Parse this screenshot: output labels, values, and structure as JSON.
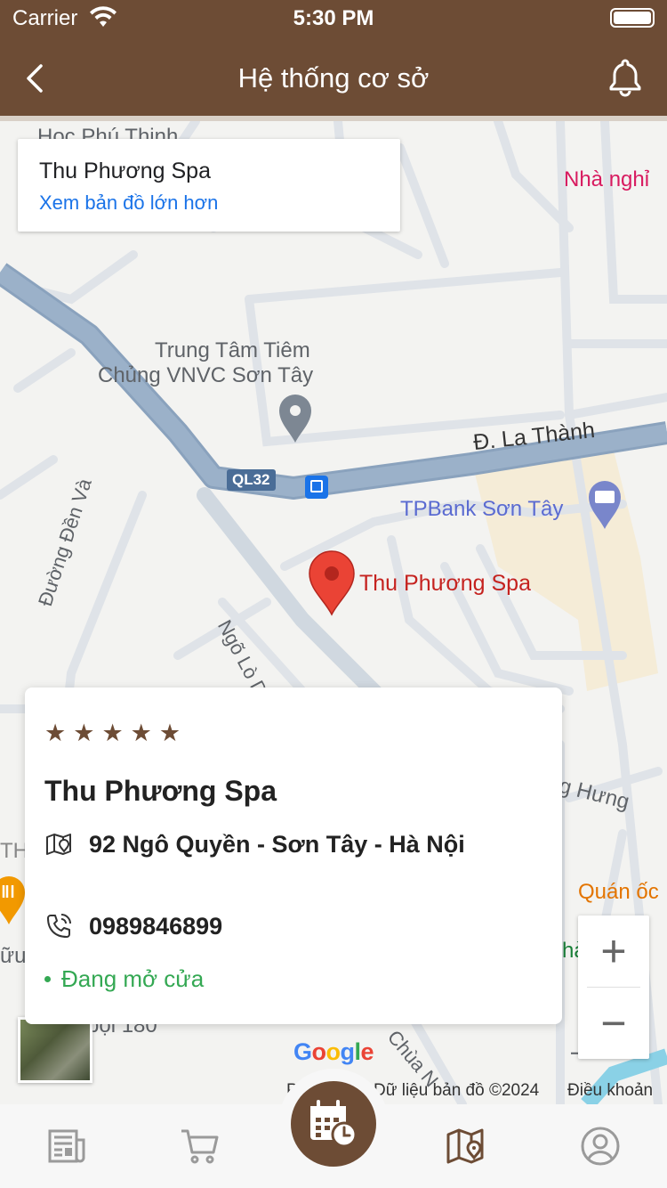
{
  "status_bar": {
    "carrier": "Carrier",
    "time": "5:30 PM"
  },
  "nav": {
    "title": "Hệ thống cơ sở",
    "back_icon": "chevron-left-icon",
    "right_icon": "bell-icon"
  },
  "map": {
    "place_card": {
      "name": "Thu Phương Spa",
      "link": "Xem bản đồ lớn hơn"
    },
    "labels": {
      "hoc_phu_thinh": "Học Phú Thịnh",
      "nha_nghi": "Nhà nghỉ",
      "vnvc_line1": "Trung Tâm Tiêm",
      "vnvc_line2": "Chủng VNVC Sơn Tây",
      "la_thanh": "Đ. La Thành",
      "ql32": "QL32",
      "tpbank": "TPBank Sơn Tây",
      "duong_den_va": "Đường Đền Và",
      "ngo_lo_d": "Ngõ Lò D",
      "pin_label": "Thu Phương Spa",
      "hung": "g Hưng",
      "quan_oc": "Quán ốc",
      "th": "TH",
      "vu": "ữu",
      "boi_180": "bội 180",
      "chua": "Chùa N",
      "nha": "hà",
      "t_edge": "T"
    },
    "zoom_in": "+",
    "zoom_out": "−",
    "google_logo": "Google",
    "attribution": {
      "left": "Phím",
      "data": "Dữ liệu bản đồ ©2024",
      "terms": "Điều khoản"
    }
  },
  "info_card": {
    "rating": 5,
    "stars": [
      "★",
      "★",
      "★",
      "★",
      "★"
    ],
    "name": "Thu Phương Spa",
    "address": "92 Ngô Quyền - Sơn Tây - Hà Nội",
    "phone": "0989846899",
    "status": "Đang mở cửa"
  },
  "tabbar": {
    "items": [
      "news-icon",
      "cart-icon",
      "calendar-clock-icon",
      "map-icon",
      "profile-icon"
    ],
    "active": "map-icon"
  },
  "colors": {
    "brand": "#6d4c35",
    "link": "#1a73e8",
    "open": "#34a853",
    "pin": "#ea4335"
  }
}
